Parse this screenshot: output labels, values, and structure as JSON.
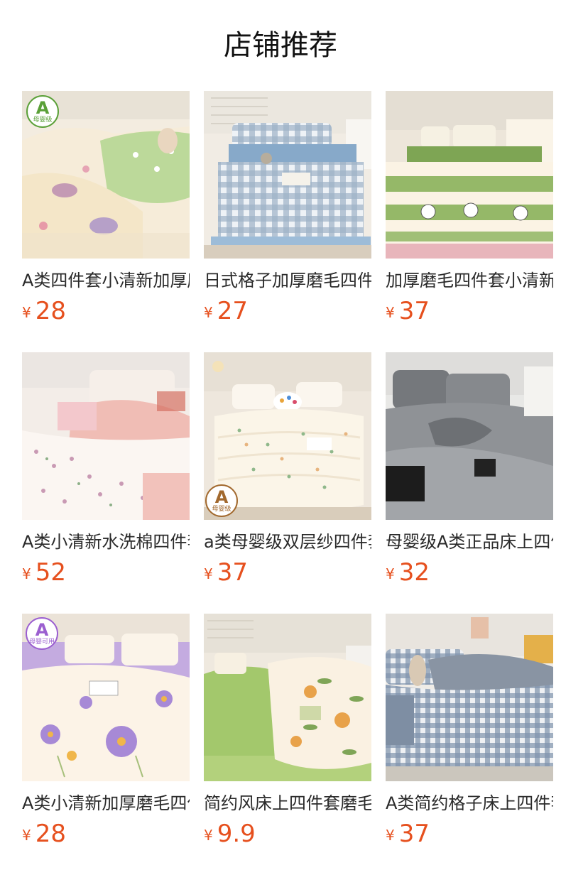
{
  "header": {
    "title": "店铺推荐"
  },
  "colors": {
    "price": "#e6501e",
    "title": "#111111",
    "name": "#2a2a2a"
  },
  "products": [
    {
      "name": "A类四件套小清新加厚磨毛",
      "currency": "¥",
      "price": "28",
      "badge": {
        "letter": "A",
        "sub": "母婴级",
        "color": "#5aa038"
      }
    },
    {
      "name": "日式格子加厚磨毛四件套",
      "currency": "¥",
      "price": "27"
    },
    {
      "name": "加厚磨毛四件套小清新床上",
      "currency": "¥",
      "price": "37"
    },
    {
      "name": "A类小清新水洗棉四件套",
      "currency": "¥",
      "price": "52"
    },
    {
      "name": "a类母婴级双层纱四件套",
      "currency": "¥",
      "price": "37",
      "badge": {
        "letter": "A",
        "sub": "母婴级",
        "color": "#a2692e"
      }
    },
    {
      "name": "母婴级A类正品床上四件套",
      "currency": "¥",
      "price": "32"
    },
    {
      "name": "A类小清新加厚磨毛四件套",
      "currency": "¥",
      "price": "28",
      "badge": {
        "letter": "A",
        "sub": "母婴可用",
        "color": "#9b5fd0"
      }
    },
    {
      "name": "简约风床上四件套磨毛加厚",
      "currency": "¥",
      "price": "9.9"
    },
    {
      "name": "A类简约格子床上四件套",
      "currency": "¥",
      "price": "37"
    }
  ]
}
